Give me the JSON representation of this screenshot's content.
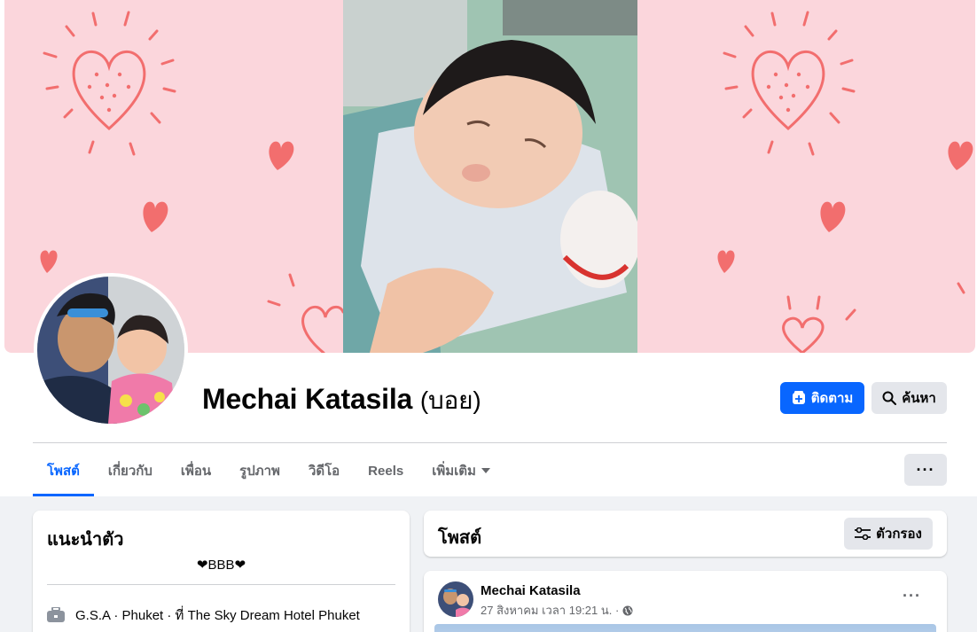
{
  "profile": {
    "name": "Mechai Katasila",
    "nickname": "(บอย)"
  },
  "actions": {
    "follow_label": "ติดตาม",
    "search_label": "ค้นหา",
    "more_label": "···"
  },
  "tabs": [
    {
      "label": "โพสต์",
      "active": true
    },
    {
      "label": "เกี่ยวกับ",
      "active": false
    },
    {
      "label": "เพื่อน",
      "active": false
    },
    {
      "label": "รูปภาพ",
      "active": false
    },
    {
      "label": "วิดีโอ",
      "active": false
    },
    {
      "label": "Reels",
      "active": false
    },
    {
      "label": "เพิ่มเติม",
      "active": false
    }
  ],
  "intro": {
    "title": "แนะนำตัว",
    "bio": "❤BBB❤",
    "work": "G.S.A · Phuket · ที่ The Sky Dream Hotel Phuket"
  },
  "posts": {
    "title": "โพสต์",
    "filter_label": "ตัวกรอง",
    "items": [
      {
        "author": "Mechai Katasila",
        "time": "27 สิงหาคม เวลา 19:21 น. ·"
      }
    ]
  },
  "icons": {
    "follow": "follow-icon",
    "search": "search-icon",
    "filter": "filter-icon",
    "work": "briefcase-icon",
    "privacy": "globe-icon",
    "dropdown": "caret-down-icon"
  },
  "colors": {
    "accent": "#0866ff",
    "cover_bg": "#fbd6dc",
    "heart": "#f26e6e",
    "page_bg": "#f0f2f5"
  }
}
